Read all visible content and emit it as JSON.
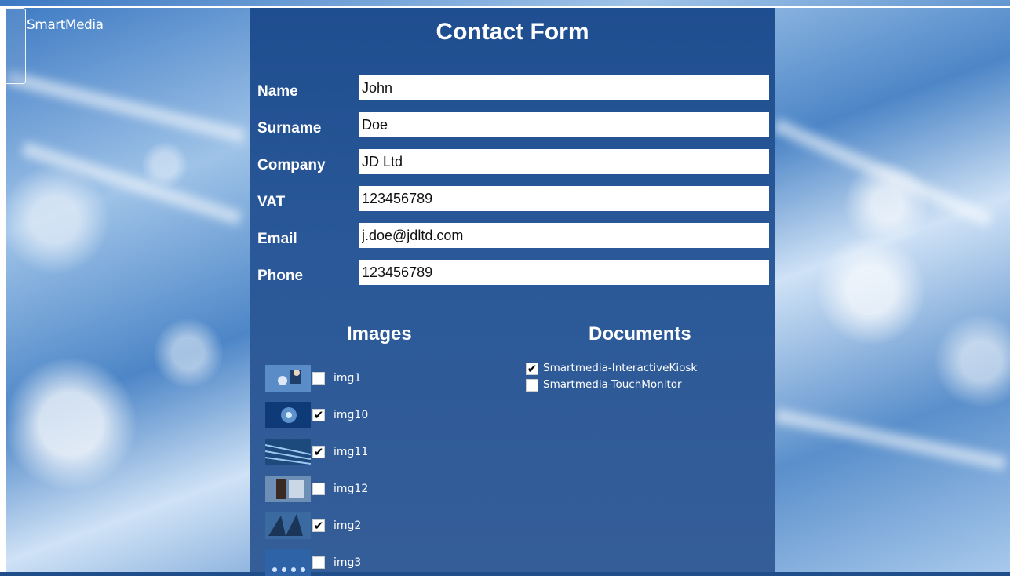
{
  "app": {
    "logo_text": "SmartMedia"
  },
  "form": {
    "title": "Contact Form",
    "fields": [
      {
        "label": "Name",
        "value": "John"
      },
      {
        "label": "Surname",
        "value": "Doe"
      },
      {
        "label": "Company",
        "value": "JD Ltd"
      },
      {
        "label": "VAT",
        "value": "123456789"
      },
      {
        "label": "Email",
        "value": "j.doe@jdltd.com"
      },
      {
        "label": "Phone",
        "value": "123456789"
      }
    ]
  },
  "images": {
    "title": "Images",
    "items": [
      {
        "label": "img1",
        "checked": false
      },
      {
        "label": "img10",
        "checked": true
      },
      {
        "label": "img11",
        "checked": true
      },
      {
        "label": "img12",
        "checked": false
      },
      {
        "label": "img2",
        "checked": true
      },
      {
        "label": "img3",
        "checked": false
      }
    ]
  },
  "documents": {
    "title": "Documents",
    "items": [
      {
        "label": "Smartmedia-InteractiveKiosk",
        "checked": true
      },
      {
        "label": "Smartmedia-TouchMonitor",
        "checked": false
      }
    ]
  },
  "colors": {
    "panel": "#2a5898",
    "accent": "#1f4e90"
  },
  "checkmark": "✔"
}
